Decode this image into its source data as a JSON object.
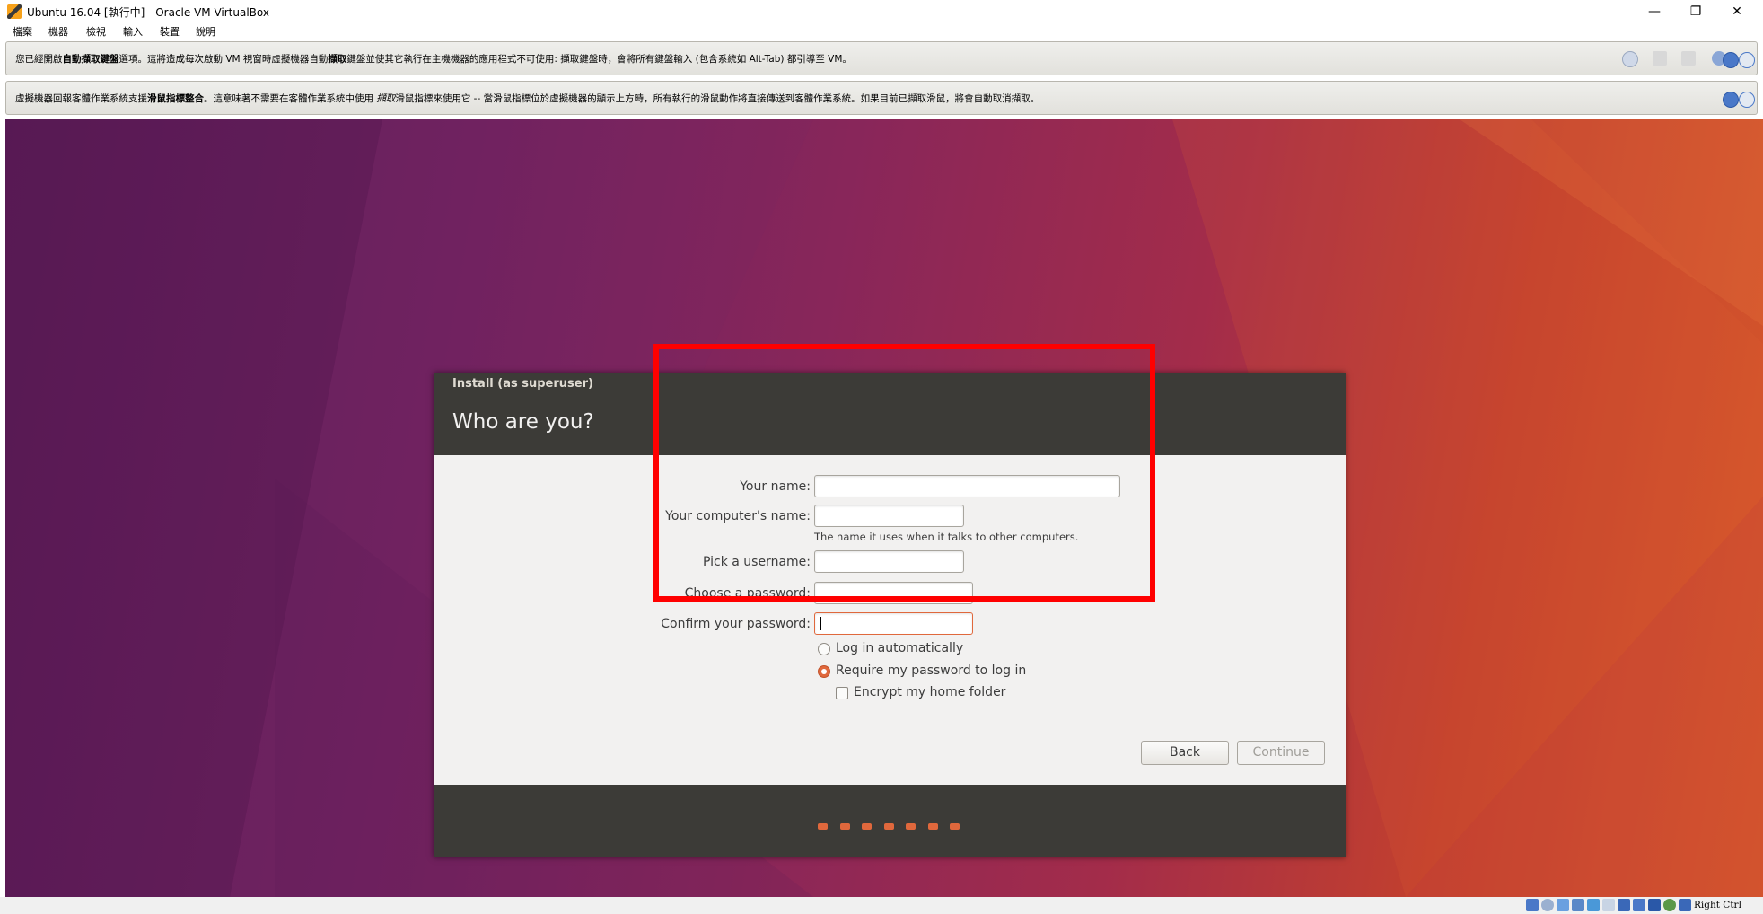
{
  "window": {
    "title": "Ubuntu 16.04 [執行中] - Oracle VM VirtualBox",
    "controls": {
      "minimize": "—",
      "restore": "❐",
      "close": "✕"
    }
  },
  "menubar": {
    "items": [
      "檔案",
      "機器",
      "檢視",
      "輸入",
      "裝置",
      "說明"
    ]
  },
  "notices": {
    "keyboard": {
      "pre": "您已經開啟",
      "bold1": "自動擷取鍵盤",
      "mid1": "選項。這將造成每次啟動 VM 視窗時虛擬機器自動",
      "bold2": "擷取",
      "mid2": "鍵盤並使其它執行在主機機器的應用程式不可使用: 擷取鍵盤時，會將所有鍵盤輸入 (包含系統如 Alt-Tab) 都引導至 VM。"
    },
    "mouse": {
      "pre": "虛擬機器回報客體作業系統支援",
      "bold": "滑鼠指標整合",
      "post": "。這意味著不需要在客體作業系統中使用 ",
      "ital": "擷取",
      "post2": "滑鼠指標來使用它 -- 當滑鼠指標位於虛擬機器的顯示上方時，所有執行的滑鼠動作將直接傳送到客體作業系統。如果目前已擷取滑鼠，將會自動取消擷取。"
    }
  },
  "installer": {
    "title": "Install (as superuser)",
    "heading": "Who are you?",
    "fields": {
      "your_name": {
        "label": "Your name:",
        "value": ""
      },
      "computer_name": {
        "label": "Your computer's name:",
        "value": "",
        "hint": "The name it uses when it talks to other computers."
      },
      "username": {
        "label": "Pick a username:",
        "value": ""
      },
      "password": {
        "label": "Choose a password:",
        "value": ""
      },
      "confirm": {
        "label": "Confirm your password:",
        "value": ""
      }
    },
    "options": {
      "login_auto": "Log in automatically",
      "require_password": "Require my password to log in",
      "encrypt_home": "Encrypt my home folder"
    },
    "selected_option": "require_password",
    "buttons": {
      "back": "Back",
      "continue": "Continue"
    },
    "progress_dots": 7,
    "accent_color": "#e0683c"
  },
  "statusbar": {
    "host_key": "Right Ctrl"
  }
}
